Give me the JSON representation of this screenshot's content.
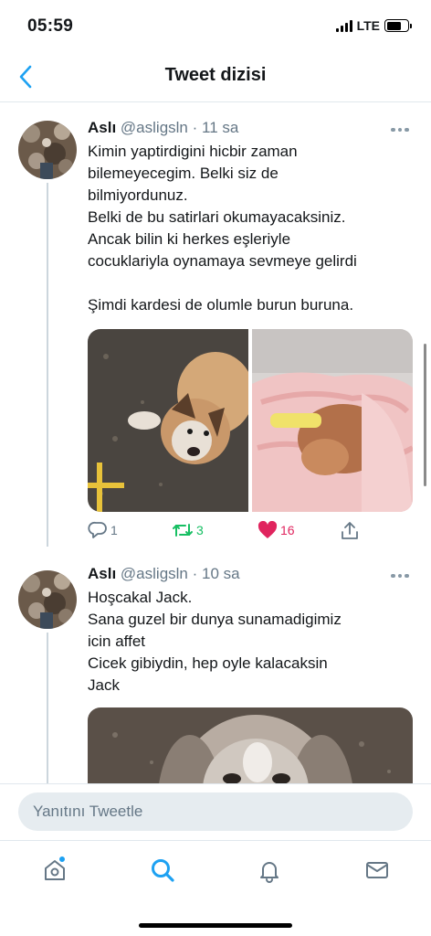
{
  "status_bar": {
    "time": "05:59",
    "network": "LTE",
    "signal_icon": "cell-signal-icon",
    "battery_icon": "battery-icon"
  },
  "header": {
    "title": "Tweet dizisi",
    "back_icon": "chevron-left-icon"
  },
  "colors": {
    "accent": "#1da1f2",
    "retweet_green": "#17bf63",
    "like_red": "#e0245e",
    "secondary_text": "#657786"
  },
  "tweets": [
    {
      "name": "Aslı",
      "handle": "@asligsln",
      "separator": "·",
      "time": "11 sa",
      "text": "Kimin yaptirdigini hicbir zaman\nbilemeyecegim. Belki siz de\nbilmiyordunuz.\nBelki de bu satirlari okumayacaksiniz.\nAncak bilin ki herkes eşleriyle\ncocuklariyla oynamaya sevmeye gelirdi\n\nŞimdi kardesi de olumle burun buruna.",
      "media": [
        "puppy-photo",
        "puppy-in-blanket-photo"
      ],
      "reply_count": "1",
      "retweet_count": "3",
      "like_count": "16"
    },
    {
      "name": "Aslı",
      "handle": "@asligsln",
      "separator": "·",
      "time": "10 sa",
      "text": "Hoşcakal Jack.\nSana guzel bir dunya sunamadigimiz\nicin affet\nCicek gibiydin, hep oyle kalacaksin\nJack",
      "media": [
        "puppy-photo"
      ]
    }
  ],
  "reply_bar": {
    "placeholder": "Yanıtını Tweetle"
  },
  "tab_bar": {
    "items": [
      "home-icon",
      "search-icon",
      "notifications-icon",
      "messages-icon"
    ],
    "active": "search-icon"
  }
}
